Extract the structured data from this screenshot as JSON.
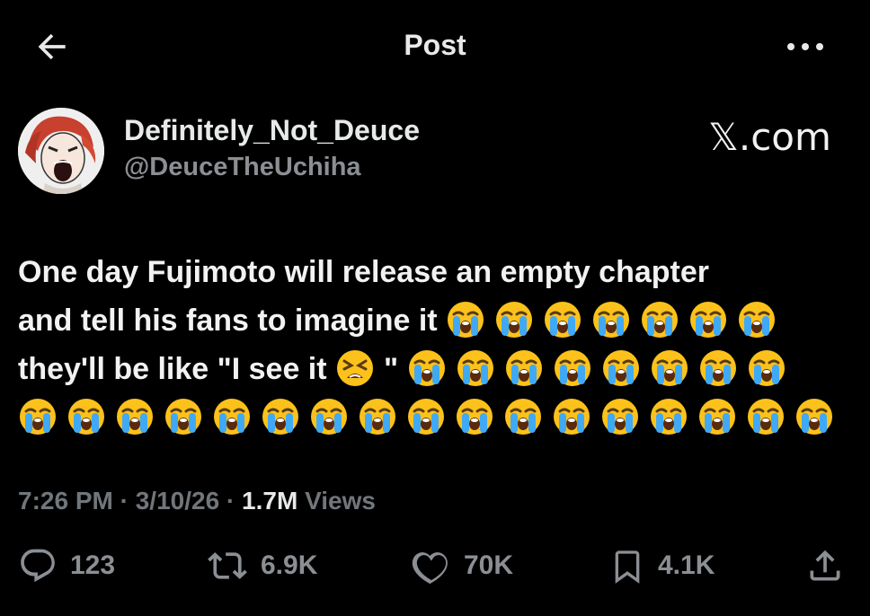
{
  "header": {
    "title": "Post",
    "back_icon": "arrow-left-icon",
    "more_icon": "ellipsis-icon"
  },
  "author": {
    "display_name": "Definitely_Not_Deuce",
    "handle": "@DeuceTheUchiha",
    "avatar_icon": "avatar-image"
  },
  "watermark": {
    "x_glyph": "𝕏",
    "suffix": ".com"
  },
  "tweet": {
    "lines": [
      {
        "text": "One day Fujimoto will release an empty chapter",
        "after": []
      },
      {
        "text": "and tell his fans to imagine it",
        "after": [
          "crying",
          "crying",
          "crying",
          "crying",
          "crying",
          "crying",
          "crying"
        ]
      },
      {
        "text": "they'll be like \"I see it",
        "mid": [
          "tired"
        ],
        "text2": "\"",
        "after": [
          "crying",
          "crying",
          "crying",
          "crying",
          "crying",
          "crying",
          "crying",
          "crying"
        ]
      },
      {
        "text": "",
        "after": [
          "crying",
          "crying",
          "crying",
          "crying",
          "crying",
          "crying",
          "crying",
          "crying",
          "crying",
          "crying",
          "crying",
          "crying",
          "crying",
          "crying",
          "crying",
          "crying",
          "crying"
        ]
      }
    ]
  },
  "meta": {
    "time": "7:26 PM",
    "date": "3/10/26",
    "views_count": "1.7M",
    "views_label": "Views"
  },
  "actions": {
    "replies": "123",
    "reposts": "6.9K",
    "likes": "70K",
    "bookmarks": "4.1K"
  },
  "colors": {
    "background": "#000000",
    "text": "#e7e9ea",
    "secondary": "#71767b",
    "emoji_face": "#fcc21b",
    "emoji_tear": "#3fa9f5"
  }
}
